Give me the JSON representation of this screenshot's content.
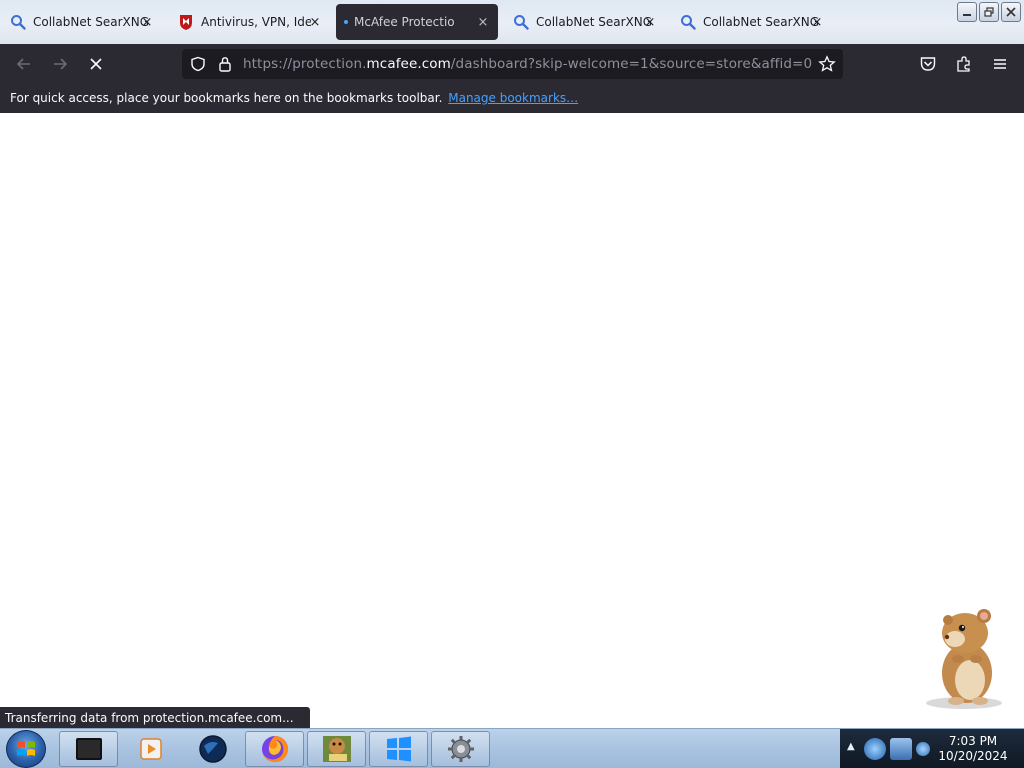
{
  "tabs": [
    {
      "title": "CollabNet SearXNG",
      "icon": "search-icon",
      "close": "×"
    },
    {
      "title": "Antivirus, VPN, Ident",
      "icon": "mcafee-shield-icon",
      "close": "×"
    },
    {
      "title": "McAfee Protection",
      "icon": "loading-dot-icon",
      "close": "×",
      "active": true
    },
    {
      "title": "CollabNet SearXNG",
      "icon": "search-icon",
      "close": "×"
    },
    {
      "title": "CollabNet SearXNG",
      "icon": "search-icon",
      "close": "×"
    }
  ],
  "url": {
    "prefix": "https://protection.",
    "host": "mcafee.com",
    "rest": "/dashboard?skip-welcome=1&source=store&affid=0"
  },
  "bookmarks": {
    "message": "For quick access, place your bookmarks here on the bookmarks toolbar.",
    "link": "Manage bookmarks…"
  },
  "status": "Transferring data from protection.mcafee.com...",
  "clock": {
    "time": "7:03 PM",
    "date": "10/20/2024"
  },
  "colors": {
    "toolbar": "#2b2a33",
    "urlbar": "#1c1b22",
    "link": "#45a1ff",
    "taskbar": "#a9c3e0"
  }
}
